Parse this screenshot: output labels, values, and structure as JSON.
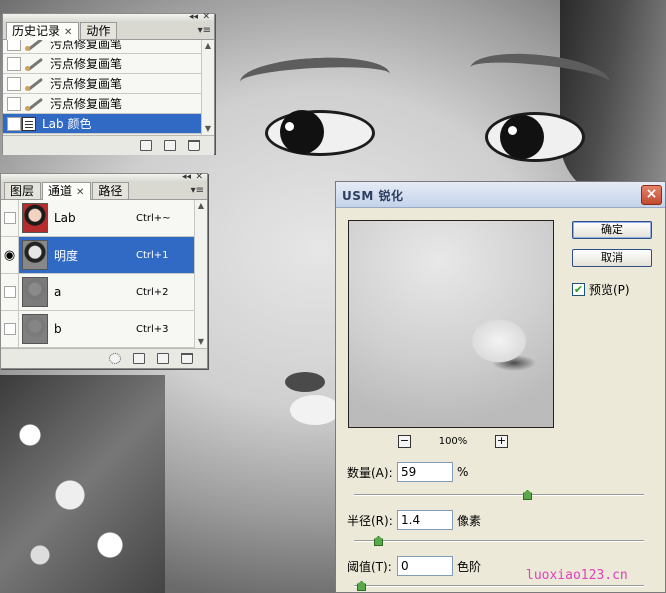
{
  "history": {
    "tabs": [
      "历史记录",
      "动作"
    ],
    "rows": [
      "污点修复画笔",
      "污点修复画笔",
      "污点修复画笔",
      "污点修复画笔",
      "Lab 颜色"
    ]
  },
  "channels": {
    "tabs": [
      "图层",
      "通道",
      "路径"
    ],
    "rows": [
      {
        "name": "Lab",
        "shortcut": "Ctrl+~"
      },
      {
        "name": "明度",
        "shortcut": "Ctrl+1"
      },
      {
        "name": "a",
        "shortcut": "Ctrl+2"
      },
      {
        "name": "b",
        "shortcut": "Ctrl+3"
      }
    ]
  },
  "usm": {
    "title": "USM 锐化",
    "ok": "确定",
    "cancel": "取消",
    "preview_label": "预览(P)",
    "preview_checked": true,
    "zoom": "100%",
    "amount": {
      "label": "数量(A):",
      "value": "59",
      "unit": "%",
      "slider": 0.59
    },
    "radius": {
      "label": "半径(R):",
      "value": "1.4",
      "unit": "像素",
      "slider": 0.06
    },
    "threshold": {
      "label": "阈值(T):",
      "value": "0",
      "unit": "色阶",
      "slider": 0.0
    }
  },
  "watermark": "luoxiao123.cn",
  "colors": {
    "selection": "#316ac5",
    "watermark": "#e13fbf",
    "checkmark": "#21a121"
  },
  "icons": {
    "close": "×",
    "eye": "👁",
    "zoom_minus": "−",
    "zoom_plus": "+",
    "palette_menu": "≡"
  }
}
